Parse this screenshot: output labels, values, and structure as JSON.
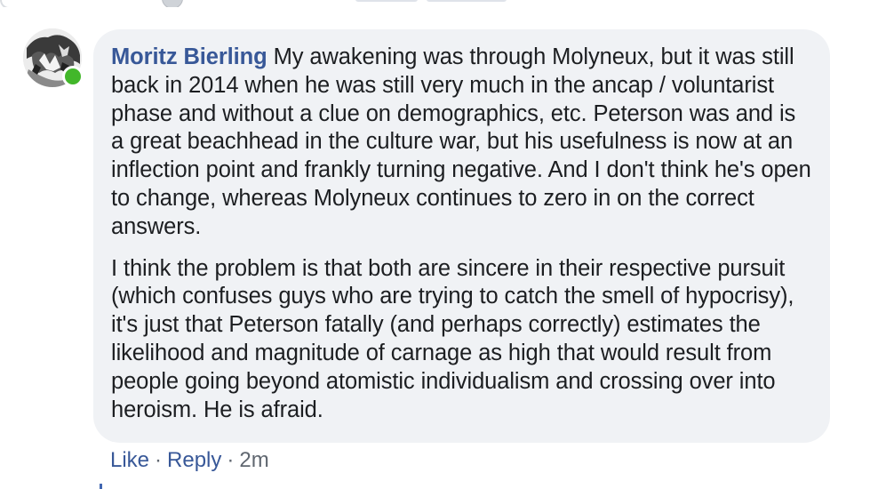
{
  "comment": {
    "author": "Moritz Bierling",
    "paragraphs": [
      "My awakening was through Molyneux, but it was still back in 2014 when he was still very much in the ancap / voluntarist phase and without a clue on demographics, etc. Peterson was and is a great beachhead in the culture war, but his usefulness is now at an inflection point and frankly turning negative. And I don't think he's open to change, whereas Molyneux continues to zero in on the correct answers.",
      "I think the problem is that both are sincere in their respective pursuit (which confuses guys who are trying to catch the smell of hypocrisy), it's just that Peterson fatally (and perhaps correctly) estimates the likelihood and magnitude of carnage as high that would result from people going beyond atomistic individualism and crossing over into heroism. He is afraid."
    ],
    "presence": "online",
    "actions": {
      "like_label": "Like",
      "reply_label": "Reply",
      "separator": "·",
      "timestamp": "2m"
    }
  },
  "colors": {
    "bubble_bg": "#f0f2f5",
    "author_link": "#385898",
    "body_text": "#1c1e21",
    "meta_text": "#606770",
    "online_dot": "#42b72a"
  },
  "icons": {
    "presence": "online-status-dot-icon",
    "avatar": "user-avatar-photo"
  }
}
